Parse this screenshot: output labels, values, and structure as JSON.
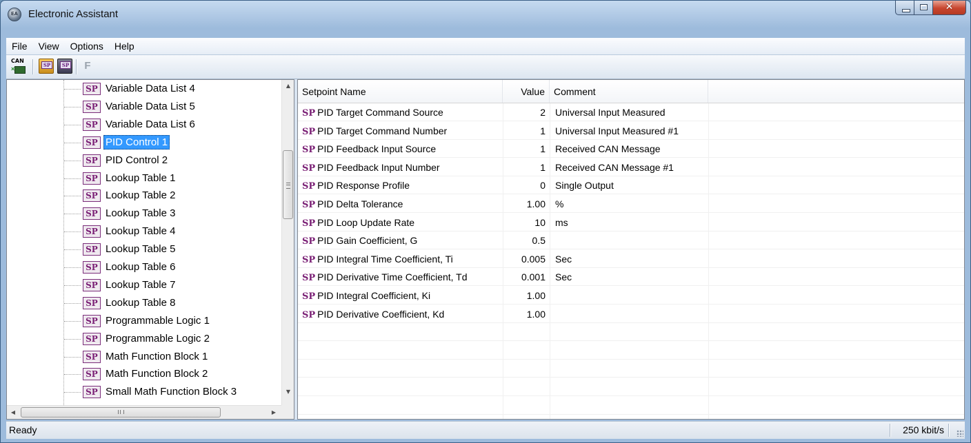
{
  "window": {
    "title": "Electronic Assistant",
    "app_icon": "app-logo-icon"
  },
  "menu": [
    "File",
    "View",
    "Options",
    "Help"
  ],
  "toolbar": {
    "can_label": "CAN",
    "open_label": "SP",
    "save_label": "SP",
    "f_label": "F"
  },
  "tree": {
    "icon_text": "SP",
    "selected_index": 3,
    "items": [
      "Variable Data List 4",
      "Variable Data List 5",
      "Variable Data List 6",
      "PID Control 1",
      "PID Control 2",
      "Lookup Table 1",
      "Lookup Table 2",
      "Lookup Table 3",
      "Lookup Table 4",
      "Lookup Table 5",
      "Lookup Table 6",
      "Lookup Table 7",
      "Lookup Table 8",
      "Programmable Logic 1",
      "Programmable Logic 2",
      "Math Function Block 1",
      "Math Function Block 2",
      "Small Math Function Block 3"
    ],
    "scroll_up": "▲",
    "scroll_down": "▼",
    "scroll_left": "◀",
    "scroll_right": "▶"
  },
  "list": {
    "columns": [
      "Setpoint Name",
      "Value",
      "Comment"
    ],
    "row_icon": "SP",
    "rows": [
      {
        "name": "PID Target Command Source",
        "value": "2",
        "comment": "Universal Input Measured"
      },
      {
        "name": "PID Target Command Number",
        "value": "1",
        "comment": "Universal Input Measured #1"
      },
      {
        "name": "PID Feedback Input Source",
        "value": "1",
        "comment": "Received CAN Message"
      },
      {
        "name": "PID Feedback Input Number",
        "value": "1",
        "comment": "Received CAN Message #1"
      },
      {
        "name": "PID Response Profile",
        "value": "0",
        "comment": "Single Output"
      },
      {
        "name": "PID Delta Tolerance",
        "value": "1.00",
        "comment": "%"
      },
      {
        "name": "PID Loop Update Rate",
        "value": "10",
        "comment": "ms"
      },
      {
        "name": "PID Gain Coefficient, G",
        "value": "0.5",
        "comment": ""
      },
      {
        "name": "PID Integral Time Coefficient, Ti",
        "value": "0.005",
        "comment": "Sec"
      },
      {
        "name": "PID Derivative Time Coefficient, Td",
        "value": "0.001",
        "comment": "Sec"
      },
      {
        "name": "PID Integral Coefficient, Ki",
        "value": "1.00",
        "comment": ""
      },
      {
        "name": "PID Derivative Coefficient, Kd",
        "value": "1.00",
        "comment": ""
      }
    ]
  },
  "status": {
    "text": "Ready",
    "rate": "250 kbit/s"
  },
  "colors": {
    "selection": "#3399ff",
    "sp_icon": "#7b2176"
  }
}
